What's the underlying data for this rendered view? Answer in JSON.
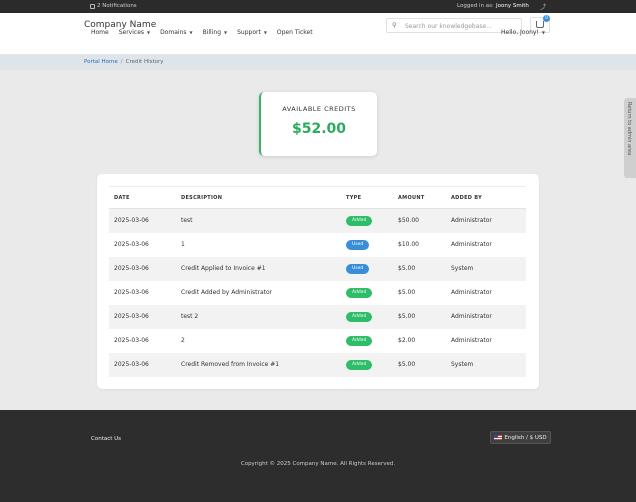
{
  "topbar": {
    "notifications": "2 Notifications",
    "logged_in_label": "Logged in as:",
    "user": "Joony Smith"
  },
  "header": {
    "brand": "Company Name",
    "search_placeholder": "Search our knowledgebase...",
    "cart_count": "0"
  },
  "nav": {
    "items": [
      {
        "label": "Home",
        "dropdown": false
      },
      {
        "label": "Services",
        "dropdown": true
      },
      {
        "label": "Domains",
        "dropdown": true
      },
      {
        "label": "Billing",
        "dropdown": true
      },
      {
        "label": "Support",
        "dropdown": true
      },
      {
        "label": "Open Ticket",
        "dropdown": false
      }
    ],
    "greeting": "Hello, Joony!"
  },
  "breadcrumb": {
    "home": "Portal Home",
    "separator": "/",
    "current": "Credit History"
  },
  "credits": {
    "label": "AVAILABLE CREDITS",
    "amount": "$52.00"
  },
  "table": {
    "columns": [
      "DATE",
      "DESCRIPTION",
      "TYPE",
      "AMOUNT",
      "ADDED BY"
    ],
    "rows": [
      {
        "date": "2025-03-06",
        "description": "test",
        "type": "Added",
        "amount": "$50.00",
        "added_by": "Administrator"
      },
      {
        "date": "2025-03-06",
        "description": "1",
        "type": "Used",
        "amount": "$10.00",
        "added_by": "Administrator"
      },
      {
        "date": "2025-03-06",
        "description": "Credit Applied to Invoice #1",
        "type": "Used",
        "amount": "$5.00",
        "added_by": "System"
      },
      {
        "date": "2025-03-06",
        "description": "Credit Added by Administrator",
        "type": "Added",
        "amount": "$5.00",
        "added_by": "Administrator"
      },
      {
        "date": "2025-03-06",
        "description": "test 2",
        "type": "Added",
        "amount": "$5.00",
        "added_by": "Administrator"
      },
      {
        "date": "2025-03-06",
        "description": "2",
        "type": "Added",
        "amount": "$2.00",
        "added_by": "Administrator"
      },
      {
        "date": "2025-03-06",
        "description": "Credit Removed from Invoice #1",
        "type": "Added",
        "amount": "$5.00",
        "added_by": "System"
      }
    ]
  },
  "side_tab": "Return to admin area",
  "footer": {
    "contact": "Contact Us",
    "language": "English / $ USD",
    "copyright": "Copyright © 2025 Company Name. All Rights Reserved."
  },
  "colors": {
    "accent_green": "#2aab5d",
    "added_badge": "#2fbd6a",
    "used_badge": "#3a8ed8",
    "link_blue": "#2f6ab5",
    "footer_bg": "#2d2d2d"
  }
}
